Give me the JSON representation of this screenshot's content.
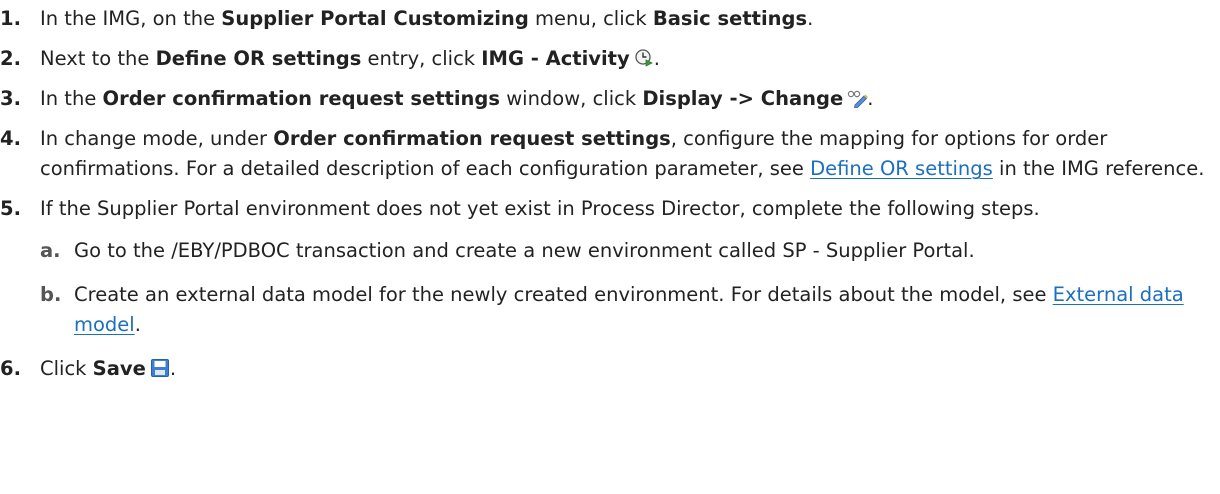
{
  "steps": [
    {
      "num": "1.",
      "t1": "In the IMG, on the ",
      "b1": "Supplier Portal Customizing",
      "t2": " menu, click ",
      "b2": "Basic settings",
      "t3": "."
    },
    {
      "num": "2.",
      "t1": "Next to the ",
      "b1": "Define OR settings",
      "t2": " entry, click ",
      "b2": "IMG - Activity",
      "t3": "."
    },
    {
      "num": "3.",
      "t1": "In the ",
      "b1": "Order confirmation request settings",
      "t2": " window, click ",
      "b2": "Display -> Change",
      "t3": "."
    },
    {
      "num": "4.",
      "t1": "In change mode, under ",
      "b1": "Order confirmation request settings",
      "t2": ", configure the mapping for options for order confirmations. For a detailed description of each configuration parameter, see ",
      "link": "Define OR settings",
      "t3": " in the IMG reference."
    },
    {
      "num": "5.",
      "text": "If the Supplier Portal environment does not yet exist in Process Director, complete the following steps.",
      "substeps": [
        {
          "letter": "a.",
          "text": "Go to the /EBY/PDBOC transaction and create a new environment called SP - Supplier Portal."
        },
        {
          "letter": "b.",
          "t1": "Create an external data model for the newly created environment. For details about the model, see ",
          "link": "External data model",
          "t2": "."
        }
      ]
    },
    {
      "num": "6.",
      "t1": "Click ",
      "b1": "Save",
      "t2": "."
    }
  ],
  "icons": {
    "img_activity": "clock-activity-icon",
    "display_change": "glasses-pencil-icon",
    "save": "floppy-disk-icon"
  },
  "colors": {
    "link": "#1a6fbf",
    "text": "#222222",
    "save_icon": "#3f7fd0"
  }
}
